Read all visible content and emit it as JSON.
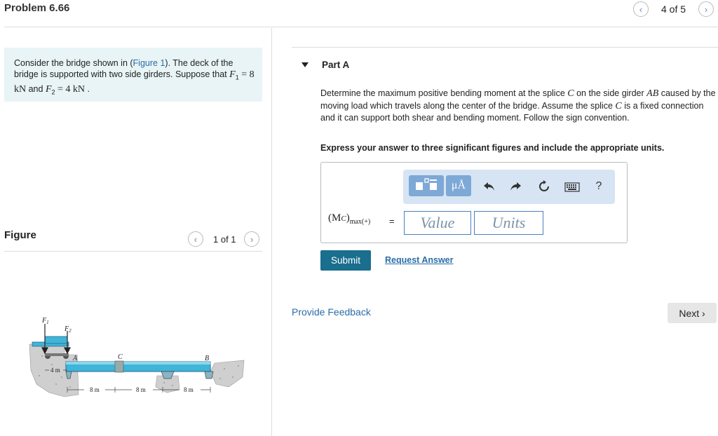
{
  "header": {
    "title": "Problem 6.66",
    "pager": "4 of 5",
    "prev_glyph": "‹",
    "next_glyph": "›"
  },
  "problem": {
    "text_a": "Consider the bridge shown in (",
    "figure_link": "Figure 1",
    "text_b": "). The deck of the bridge is supported with two side girders. Suppose that ",
    "f1_sym": "F",
    "f1_sub": "1",
    "f1_val": " = 8  kN",
    "and": " and ",
    "f2_sym": "F",
    "f2_sub": "2",
    "f2_val": " = 4  kN",
    "end": " ."
  },
  "figure": {
    "label": "Figure",
    "pager": "1 of 1",
    "labels": {
      "F1": "F",
      "F1_sub": "1",
      "F2": "F",
      "F2_sub": "2",
      "A": "A",
      "C": "C",
      "B": "B",
      "dim_4m": "4 m",
      "dim_8m_1": "8 m",
      "dim_8m_2": "8 m",
      "dim_8m_3": "8 m"
    }
  },
  "partA": {
    "title": "Part A",
    "q1": "Determine the maximum positive bending moment at the splice ",
    "c": "C",
    "q2": " on the side girder ",
    "ab": "AB",
    "q3": " caused by the moving load which travels along the center of the bridge. Assume the splice ",
    "c2": "C",
    "q4": " is a fixed connection and it can support both shear and bending moment. Follow the sign convention.",
    "instruction": "Express your answer to three significant figures and include the appropriate units.",
    "lhs_main": "(M",
    "lhs_c": "C",
    "lhs_close": ")",
    "lhs_sub": "max(+)",
    "equals": "=",
    "value_placeholder": "Value",
    "units_placeholder": "Units",
    "toolbar": {
      "templates_icon": "templates-icon",
      "units_label": "μÅ",
      "undo_icon": "undo-icon",
      "redo_icon": "redo-icon",
      "reset_icon": "reset-icon",
      "keyboard_icon": "keyboard-icon",
      "help_label": "?"
    },
    "submit": "Submit",
    "request_answer": "Request Answer"
  },
  "footer": {
    "feedback": "Provide Feedback",
    "next": "Next ›"
  },
  "colors": {
    "accent": "#1a6e8e",
    "link": "#2a6ca8",
    "problem_bg": "#e8f4f5",
    "toolbar_bg": "#d6e4f3",
    "toolbar_btn": "#7ea8d6"
  }
}
